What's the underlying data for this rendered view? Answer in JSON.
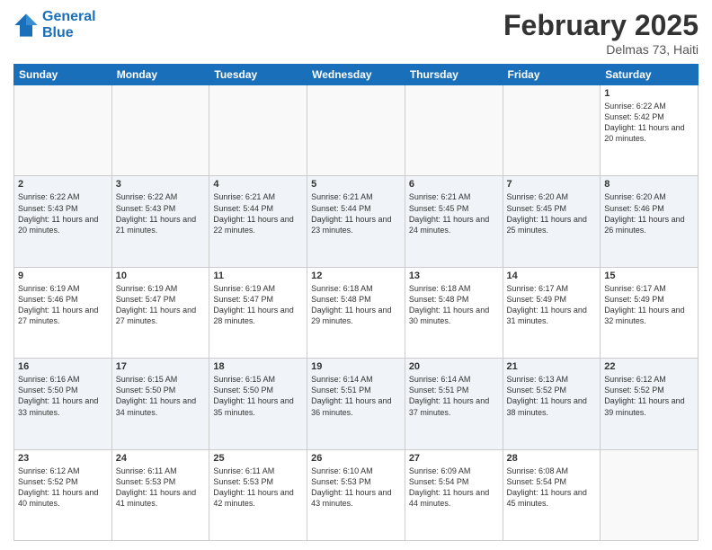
{
  "header": {
    "logo_line1": "General",
    "logo_line2": "Blue",
    "month_title": "February 2025",
    "location": "Delmas 73, Haiti"
  },
  "days_of_week": [
    "Sunday",
    "Monday",
    "Tuesday",
    "Wednesday",
    "Thursday",
    "Friday",
    "Saturday"
  ],
  "weeks": [
    [
      {
        "day": "",
        "info": ""
      },
      {
        "day": "",
        "info": ""
      },
      {
        "day": "",
        "info": ""
      },
      {
        "day": "",
        "info": ""
      },
      {
        "day": "",
        "info": ""
      },
      {
        "day": "",
        "info": ""
      },
      {
        "day": "1",
        "info": "Sunrise: 6:22 AM\nSunset: 5:42 PM\nDaylight: 11 hours and 20 minutes."
      }
    ],
    [
      {
        "day": "2",
        "info": "Sunrise: 6:22 AM\nSunset: 5:43 PM\nDaylight: 11 hours and 20 minutes."
      },
      {
        "day": "3",
        "info": "Sunrise: 6:22 AM\nSunset: 5:43 PM\nDaylight: 11 hours and 21 minutes."
      },
      {
        "day": "4",
        "info": "Sunrise: 6:21 AM\nSunset: 5:44 PM\nDaylight: 11 hours and 22 minutes."
      },
      {
        "day": "5",
        "info": "Sunrise: 6:21 AM\nSunset: 5:44 PM\nDaylight: 11 hours and 23 minutes."
      },
      {
        "day": "6",
        "info": "Sunrise: 6:21 AM\nSunset: 5:45 PM\nDaylight: 11 hours and 24 minutes."
      },
      {
        "day": "7",
        "info": "Sunrise: 6:20 AM\nSunset: 5:45 PM\nDaylight: 11 hours and 25 minutes."
      },
      {
        "day": "8",
        "info": "Sunrise: 6:20 AM\nSunset: 5:46 PM\nDaylight: 11 hours and 26 minutes."
      }
    ],
    [
      {
        "day": "9",
        "info": "Sunrise: 6:19 AM\nSunset: 5:46 PM\nDaylight: 11 hours and 27 minutes."
      },
      {
        "day": "10",
        "info": "Sunrise: 6:19 AM\nSunset: 5:47 PM\nDaylight: 11 hours and 27 minutes."
      },
      {
        "day": "11",
        "info": "Sunrise: 6:19 AM\nSunset: 5:47 PM\nDaylight: 11 hours and 28 minutes."
      },
      {
        "day": "12",
        "info": "Sunrise: 6:18 AM\nSunset: 5:48 PM\nDaylight: 11 hours and 29 minutes."
      },
      {
        "day": "13",
        "info": "Sunrise: 6:18 AM\nSunset: 5:48 PM\nDaylight: 11 hours and 30 minutes."
      },
      {
        "day": "14",
        "info": "Sunrise: 6:17 AM\nSunset: 5:49 PM\nDaylight: 11 hours and 31 minutes."
      },
      {
        "day": "15",
        "info": "Sunrise: 6:17 AM\nSunset: 5:49 PM\nDaylight: 11 hours and 32 minutes."
      }
    ],
    [
      {
        "day": "16",
        "info": "Sunrise: 6:16 AM\nSunset: 5:50 PM\nDaylight: 11 hours and 33 minutes."
      },
      {
        "day": "17",
        "info": "Sunrise: 6:15 AM\nSunset: 5:50 PM\nDaylight: 11 hours and 34 minutes."
      },
      {
        "day": "18",
        "info": "Sunrise: 6:15 AM\nSunset: 5:50 PM\nDaylight: 11 hours and 35 minutes."
      },
      {
        "day": "19",
        "info": "Sunrise: 6:14 AM\nSunset: 5:51 PM\nDaylight: 11 hours and 36 minutes."
      },
      {
        "day": "20",
        "info": "Sunrise: 6:14 AM\nSunset: 5:51 PM\nDaylight: 11 hours and 37 minutes."
      },
      {
        "day": "21",
        "info": "Sunrise: 6:13 AM\nSunset: 5:52 PM\nDaylight: 11 hours and 38 minutes."
      },
      {
        "day": "22",
        "info": "Sunrise: 6:12 AM\nSunset: 5:52 PM\nDaylight: 11 hours and 39 minutes."
      }
    ],
    [
      {
        "day": "23",
        "info": "Sunrise: 6:12 AM\nSunset: 5:52 PM\nDaylight: 11 hours and 40 minutes."
      },
      {
        "day": "24",
        "info": "Sunrise: 6:11 AM\nSunset: 5:53 PM\nDaylight: 11 hours and 41 minutes."
      },
      {
        "day": "25",
        "info": "Sunrise: 6:11 AM\nSunset: 5:53 PM\nDaylight: 11 hours and 42 minutes."
      },
      {
        "day": "26",
        "info": "Sunrise: 6:10 AM\nSunset: 5:53 PM\nDaylight: 11 hours and 43 minutes."
      },
      {
        "day": "27",
        "info": "Sunrise: 6:09 AM\nSunset: 5:54 PM\nDaylight: 11 hours and 44 minutes."
      },
      {
        "day": "28",
        "info": "Sunrise: 6:08 AM\nSunset: 5:54 PM\nDaylight: 11 hours and 45 minutes."
      },
      {
        "day": "",
        "info": ""
      }
    ]
  ]
}
